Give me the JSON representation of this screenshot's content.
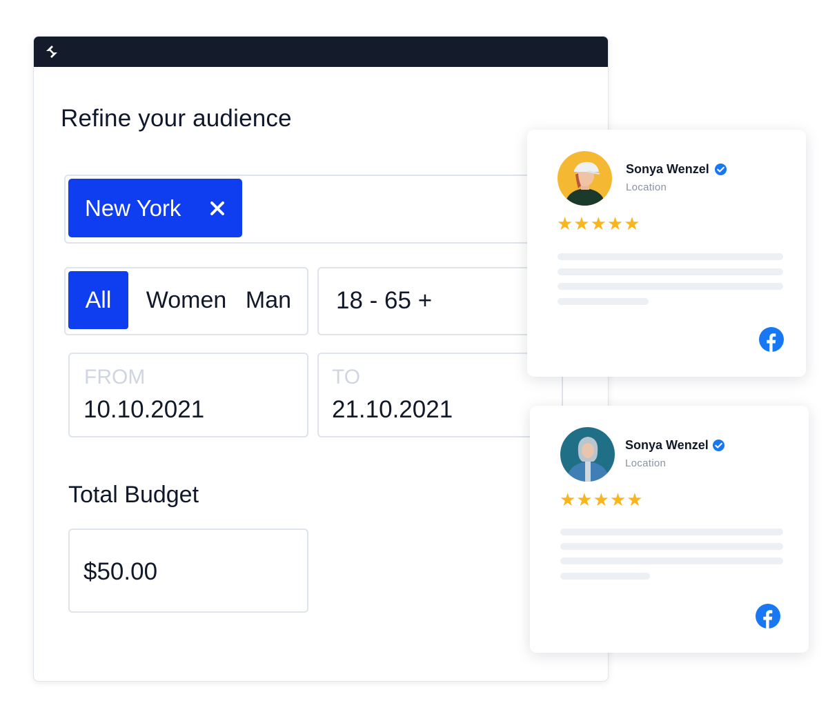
{
  "form": {
    "heading": "Refine your audience",
    "location_chip": "New York",
    "gender_options": [
      "All",
      "Women",
      "Man"
    ],
    "gender_selected": "All",
    "age_range": "18 - 65 +",
    "from_label": "FROM",
    "from_date": "10.10.2021",
    "to_label": "TO",
    "to_date": "21.10.2021",
    "budget_title": "Total Budget",
    "budget_value": "$50.00"
  },
  "reviews": [
    {
      "name": "Sonya Wenzel",
      "location": "Location",
      "rating": 5,
      "stars": "★★★★★",
      "platform": "facebook-icon"
    },
    {
      "name": "Sonya Wenzel",
      "location": "Location",
      "rating": 5,
      "stars": "★★★★★",
      "platform": "facebook-icon"
    }
  ],
  "colors": {
    "accent": "#0f3df0",
    "titlebar": "#141b2b",
    "star": "#f8b51d",
    "verified": "#1877f2",
    "facebook": "#1877f2"
  }
}
